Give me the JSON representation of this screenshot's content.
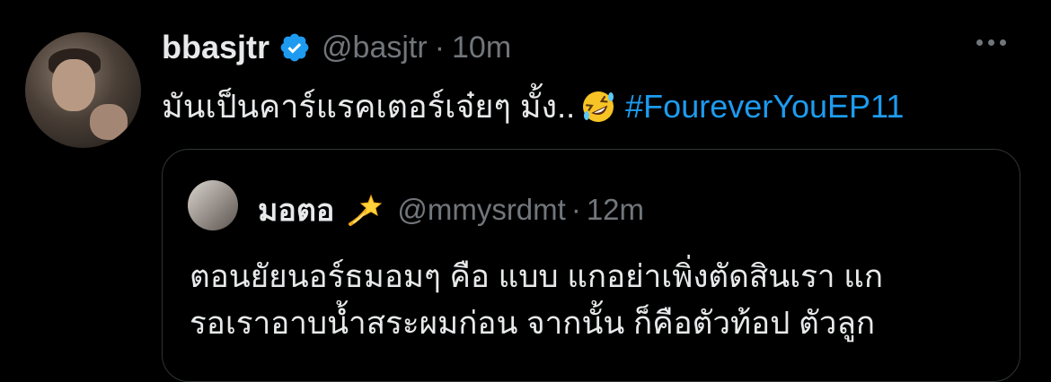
{
  "tweet": {
    "display_name": "bbasjtr",
    "handle": "@basjtr",
    "separator": "·",
    "time": "10m",
    "text": "มันเป็นคาร์แรคเตอร์เจ๋ยๆ มั้ง..",
    "emoji_icon": "rofl-emoji-icon",
    "hashtag": "#FoureverYouEP11"
  },
  "quote": {
    "display_name": "มอตอ",
    "emoji_icon": "dizzy-emoji-icon",
    "handle": "@mmysrdmt",
    "separator": "·",
    "time": "12m",
    "line1": "ตอนยัยนอร์ธมอมๆ คือ แบบ แกอย่าเพิ่งตัดสินเรา แก",
    "line2": "รอเราอาบน้ำสระผมก่อน จากนั้น ก็คือตัวท้อป ตัวลูก"
  },
  "colors": {
    "background": "#000000",
    "text": "#e7e9ea",
    "muted": "#71767b",
    "link": "#1d9bf0",
    "border": "#2f3336"
  }
}
